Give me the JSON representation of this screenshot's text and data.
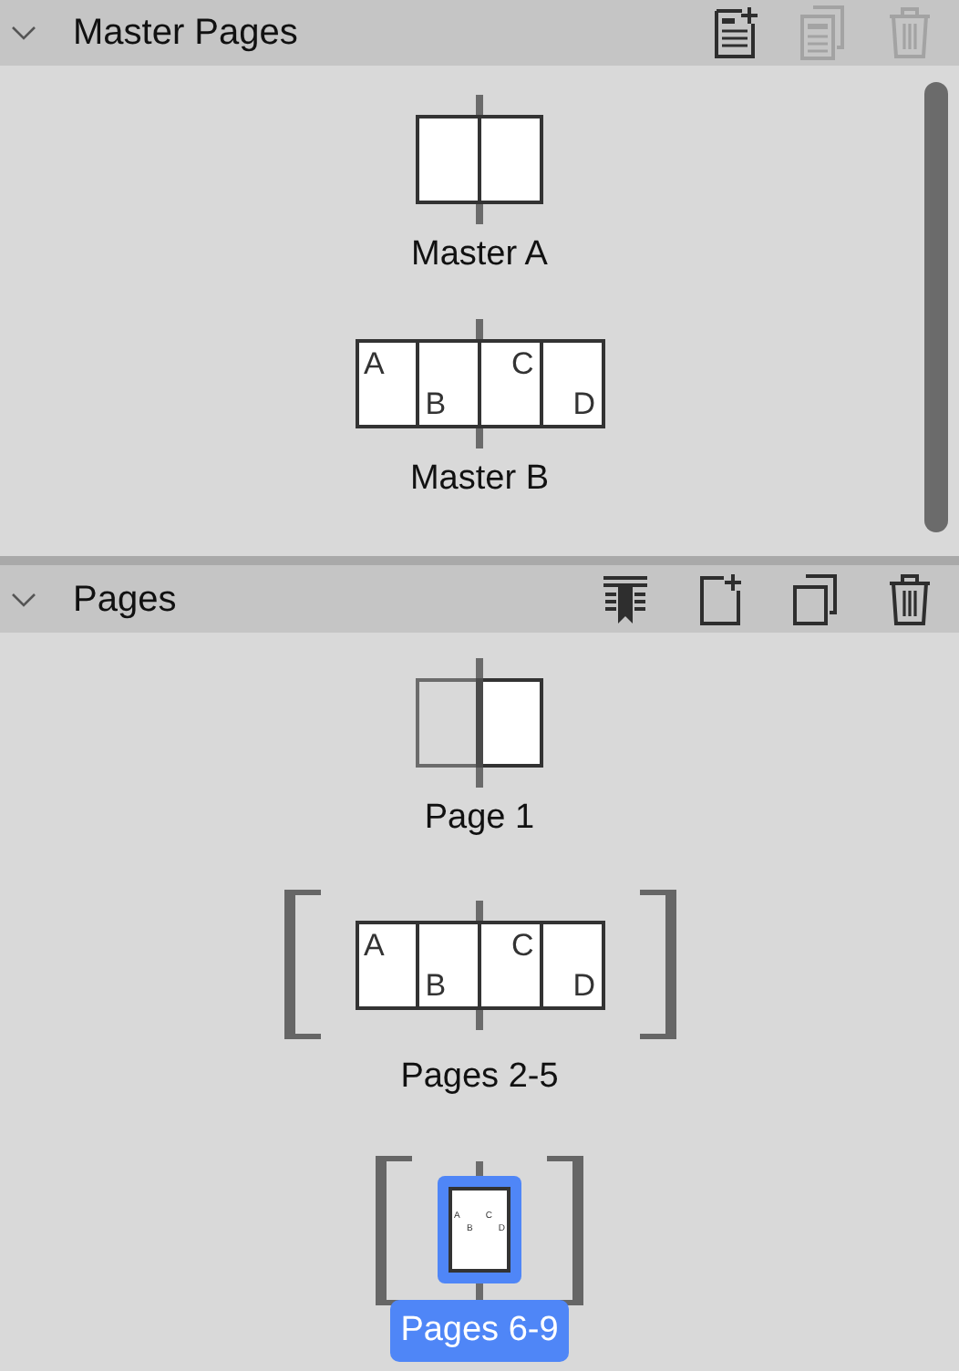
{
  "sections": [
    {
      "title": "Master Pages",
      "expanded": true,
      "scrollbar": true,
      "tools": [
        {
          "kind": "new-lined",
          "disabled": false
        },
        {
          "kind": "duplicate-lined",
          "disabled": true
        },
        {
          "kind": "trash",
          "disabled": true
        }
      ],
      "items": [
        {
          "label": "Master A",
          "kind": "spread",
          "bracketed": false,
          "selected": false
        },
        {
          "label": "Master B",
          "kind": "spread",
          "bracketed": false,
          "selected": false,
          "letters": [
            "A",
            "B",
            "C",
            "D"
          ]
        }
      ]
    },
    {
      "title": "Pages",
      "expanded": true,
      "scrollbar": false,
      "tools": [
        {
          "kind": "insert",
          "disabled": false
        },
        {
          "kind": "new",
          "disabled": false
        },
        {
          "kind": "duplicate",
          "disabled": false
        },
        {
          "kind": "trash",
          "disabled": false
        }
      ],
      "items": [
        {
          "label": "Page 1",
          "kind": "right",
          "bracketed": false,
          "selected": false
        },
        {
          "label": "Pages 2-5",
          "kind": "spread",
          "bracketed": true,
          "selected": false,
          "letters": [
            "A",
            "B",
            "C",
            "D"
          ]
        },
        {
          "label": "Pages 6-9",
          "kind": "mini",
          "bracketed": true,
          "selected": true,
          "letters": [
            "A",
            "B",
            "C",
            "D"
          ]
        }
      ]
    }
  ]
}
